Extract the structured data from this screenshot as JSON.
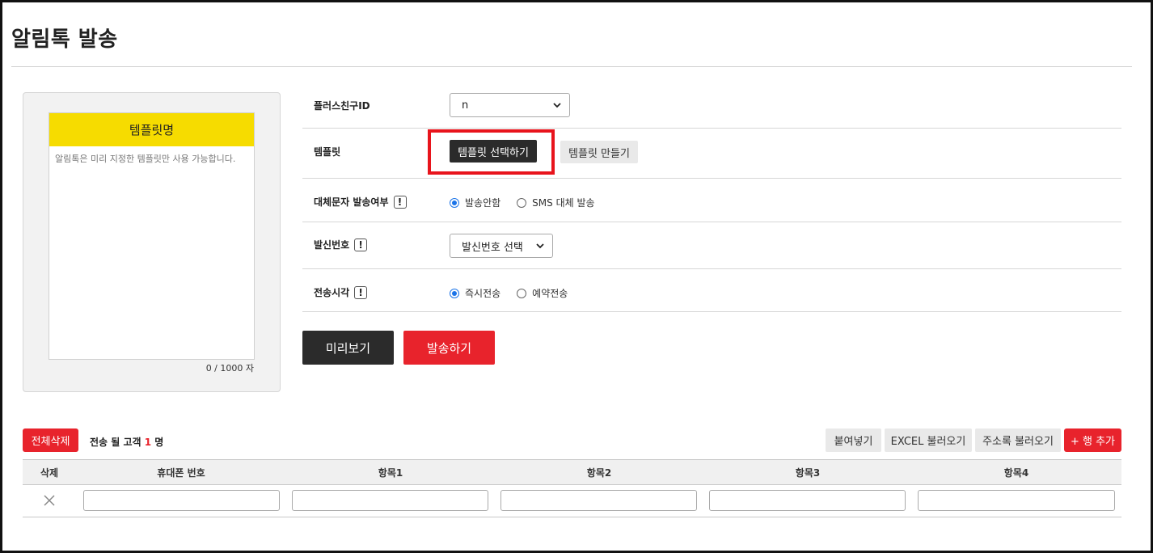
{
  "page": {
    "title": "알림톡 발송"
  },
  "preview": {
    "template_name": "템플릿명",
    "body_text": "알림톡은 미리 지정한 템플릿만 사용 가능합니다.",
    "counter": "0 / 1000 자"
  },
  "form": {
    "plus_friend": {
      "label": "플러스친구ID",
      "value": "n"
    },
    "template": {
      "label": "템플릿",
      "select_button": "템플릿 선택하기",
      "create_button": "템플릿 만들기"
    },
    "fallback": {
      "label": "대체문자 발송여부",
      "options": [
        "발송안함",
        "SMS 대체 발송"
      ],
      "selected": "발송안함"
    },
    "sender": {
      "label": "발신번호",
      "value": "발신번호 선택"
    },
    "send_time": {
      "label": "전송시각",
      "options": [
        "즉시전송",
        "예약전송"
      ],
      "selected": "즉시전송"
    },
    "info_mark": "!"
  },
  "actions": {
    "preview_button": "미리보기",
    "send_button": "발송하기"
  },
  "recipients": {
    "delete_all_button": "전체삭제",
    "count_prefix": "전송 될 고객",
    "count_value": "1",
    "count_suffix": "명",
    "paste_button": "붙여넣기",
    "excel_button": "EXCEL 불러오기",
    "addressbook_button": "주소록 불러오기",
    "add_row_button": "+ 행 추가",
    "columns": [
      "삭제",
      "휴대폰 번호",
      "항목1",
      "항목2",
      "항목3",
      "항목4"
    ]
  },
  "colors": {
    "accent_red": "#e8232c",
    "template_header_yellow": "#f6dc00",
    "dark_button": "#2b2b2b"
  },
  "icons": {
    "info": "info-icon",
    "select_arrow": "chevron-down-icon",
    "delete": "close-icon"
  }
}
